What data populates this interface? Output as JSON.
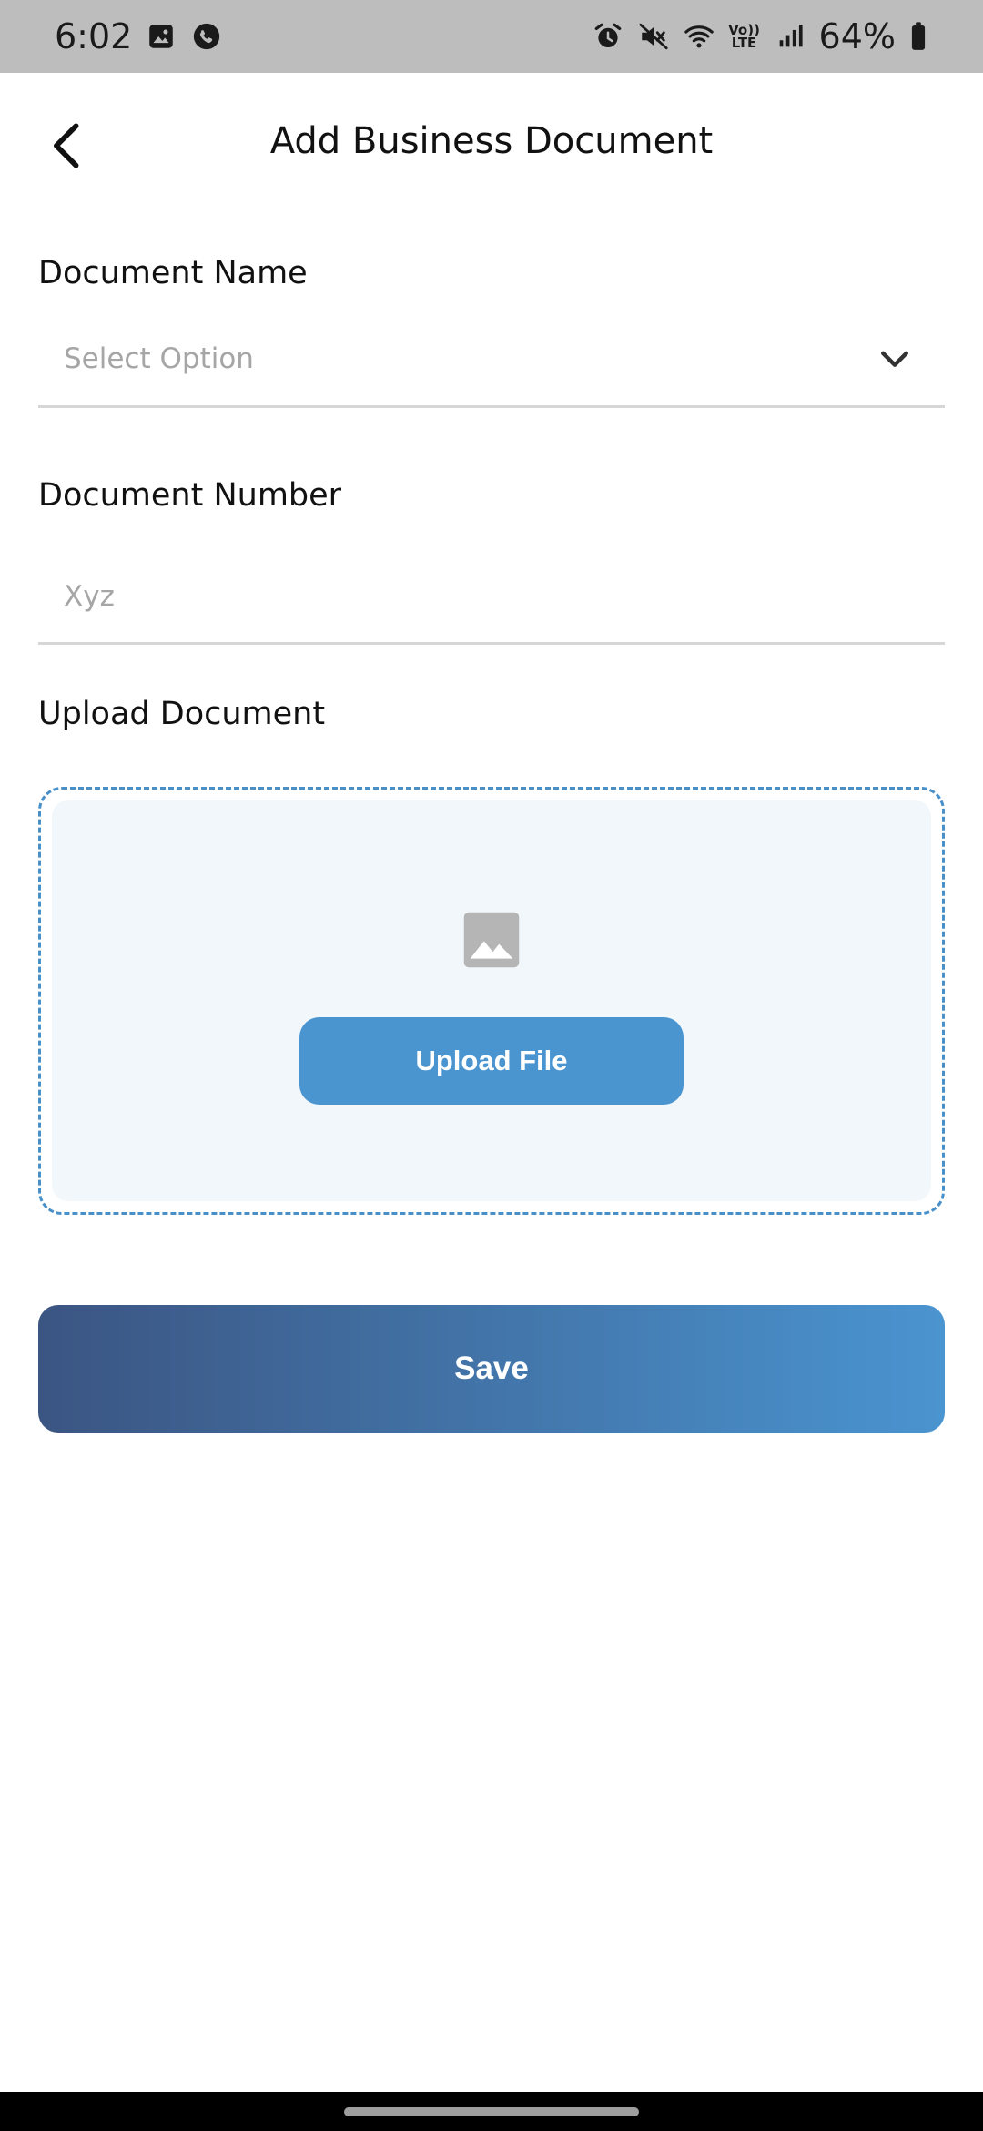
{
  "status_bar": {
    "time": "6:02",
    "battery_percent": "64%",
    "volte_label_top": "Vo))",
    "volte_label_bottom": "LTE",
    "icons": [
      "gallery-icon",
      "phone-app-icon",
      "alarm-icon",
      "mute-icon",
      "wifi-icon",
      "volte-icon",
      "signal-icon",
      "battery-icon"
    ]
  },
  "header": {
    "title": "Add Business Document",
    "back_icon": "chevron-left-icon"
  },
  "form": {
    "document_name": {
      "label": "Document Name",
      "value": "Select Option",
      "icon": "chevron-down-icon"
    },
    "document_number": {
      "label": "Document Number",
      "placeholder": "Xyz"
    },
    "upload": {
      "label": "Upload Document",
      "icon": "image-icon",
      "button_label": "Upload File"
    },
    "save_label": "Save"
  },
  "colors": {
    "accent": "#4a94d0",
    "save_gradient_start": "#3b5582",
    "save_gradient_end": "#4a94d0",
    "status_bar_bg": "#bdbdbd",
    "upload_border": "#4a90c8",
    "upload_bg": "#f1f7fa"
  }
}
